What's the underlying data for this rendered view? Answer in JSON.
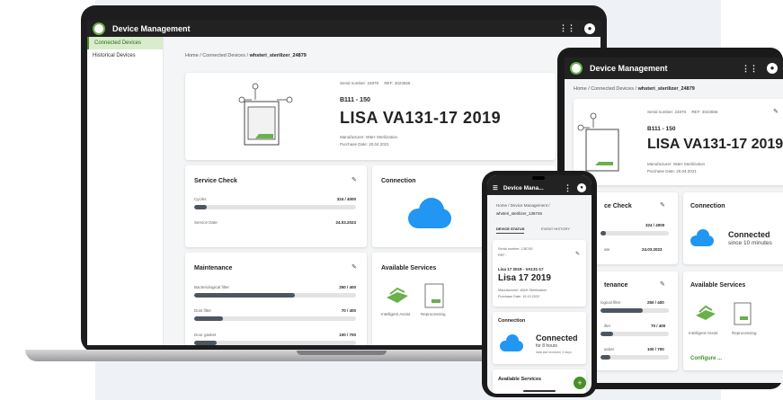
{
  "app": {
    "title": "Device Management"
  },
  "sidebar": {
    "items": [
      {
        "label": "Connected Devices"
      },
      {
        "label": "Historical Devices"
      }
    ]
  },
  "breadcrumb": {
    "home": "Home",
    "sep": "/",
    "connected": "Connected Devices",
    "device": "whsteri_sterilizer_24879"
  },
  "device": {
    "serial_label": "Serial number:",
    "serial": "24879",
    "ref_label": "REF:",
    "ref": "3023656",
    "model_code": "B111 - 150",
    "name": "LISA VA131-17 2019",
    "manufacturer_label": "Manufacturer:",
    "manufacturer": "W&H Sterilization",
    "purchase_label": "Purchase Date:",
    "purchase_date": "20.04.2021"
  },
  "service_check": {
    "title": "Service Check",
    "cycles_label": "Cycles",
    "cycles_value": "324 / 4000",
    "cycles_fraction": 0.08,
    "date_label": "Service Date",
    "date_value": "24.03.2023"
  },
  "connection": {
    "title": "Connection",
    "status": "Connected",
    "since": "since 10 minutes"
  },
  "maintenance": {
    "title": "Maintenance",
    "items": [
      {
        "label": "Bacteriological filter",
        "value": "250 / 400",
        "fraction": 0.62
      },
      {
        "label": "Dust filter",
        "value": "70 / 400",
        "fraction": 0.18
      },
      {
        "label": "Door gasket",
        "value": "100 / 700",
        "fraction": 0.14
      }
    ]
  },
  "services": {
    "title": "Available Services",
    "items": [
      {
        "label": "Intelligent Assist"
      },
      {
        "label": "Reprocessing"
      }
    ],
    "configure": "Configure ..."
  },
  "tablet": {
    "service_check": "ce Check",
    "maintenance": "tenance",
    "bact": "logical filter",
    "dust": "ilter",
    "gasket": "asket",
    "date": "ate"
  },
  "phone": {
    "title": "Device Mana...",
    "crumb1": "Home / Device Management /",
    "crumb2": "whsteri_sterilizer_136745",
    "tab1": "DEVICE STATUS",
    "tab2": "EVENT HISTORY",
    "serial_label": "Serial number:",
    "serial": "136745",
    "ref_label": "REF:",
    "model_code": "Lisa 17 2019 - VA131-17",
    "name": "Lisa 17 2019",
    "manufacturer_label": "Manufacturer:",
    "manufacturer": "W&H Sterilization",
    "purchase_label": "Purchase Date:",
    "purchase_date": "15.10.2022",
    "conn_title": "Connection",
    "conn_status": "Connected",
    "conn_since": "for 8 hours",
    "conn_note": "data last received: 3 days",
    "services_title": "Available Services",
    "fab": "+"
  },
  "colors": {
    "accent": "#4a8f2a",
    "cloud": "#2196f3",
    "appbar": "#222222"
  }
}
